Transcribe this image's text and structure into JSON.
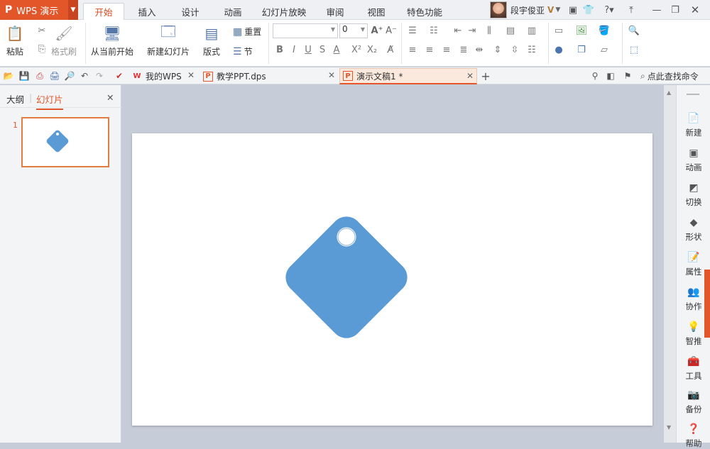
{
  "app": {
    "logo": "P",
    "name": "WPS 演示"
  },
  "menu_tabs": [
    "开始",
    "插入",
    "设计",
    "动画",
    "幻灯片放映",
    "审阅",
    "视图",
    "特色功能"
  ],
  "user": {
    "name": "段宇俊亚",
    "badge": "V"
  },
  "ribbon": {
    "paste": "粘贴",
    "format_painter": "格式刷",
    "from_current": "从当前开始",
    "new_slide": "新建幻灯片",
    "layout": "版式",
    "reset": "重置",
    "section": "节",
    "font_size": "0"
  },
  "doc_tabs": [
    "我的WPS",
    "教学PPT.dps",
    "演示文稿1 *"
  ],
  "search_command": "点此查找命令",
  "left_panel": {
    "outline_tab": "大纲",
    "slides_tab": "幻灯片",
    "slide_number": "1"
  },
  "right_bar": [
    "新建",
    "动画",
    "切换",
    "形状",
    "属性",
    "协作",
    "智推",
    "工具",
    "备份",
    "帮助"
  ],
  "colors": {
    "accent": "#e2562a",
    "shape_fill": "#5b9bd5"
  }
}
